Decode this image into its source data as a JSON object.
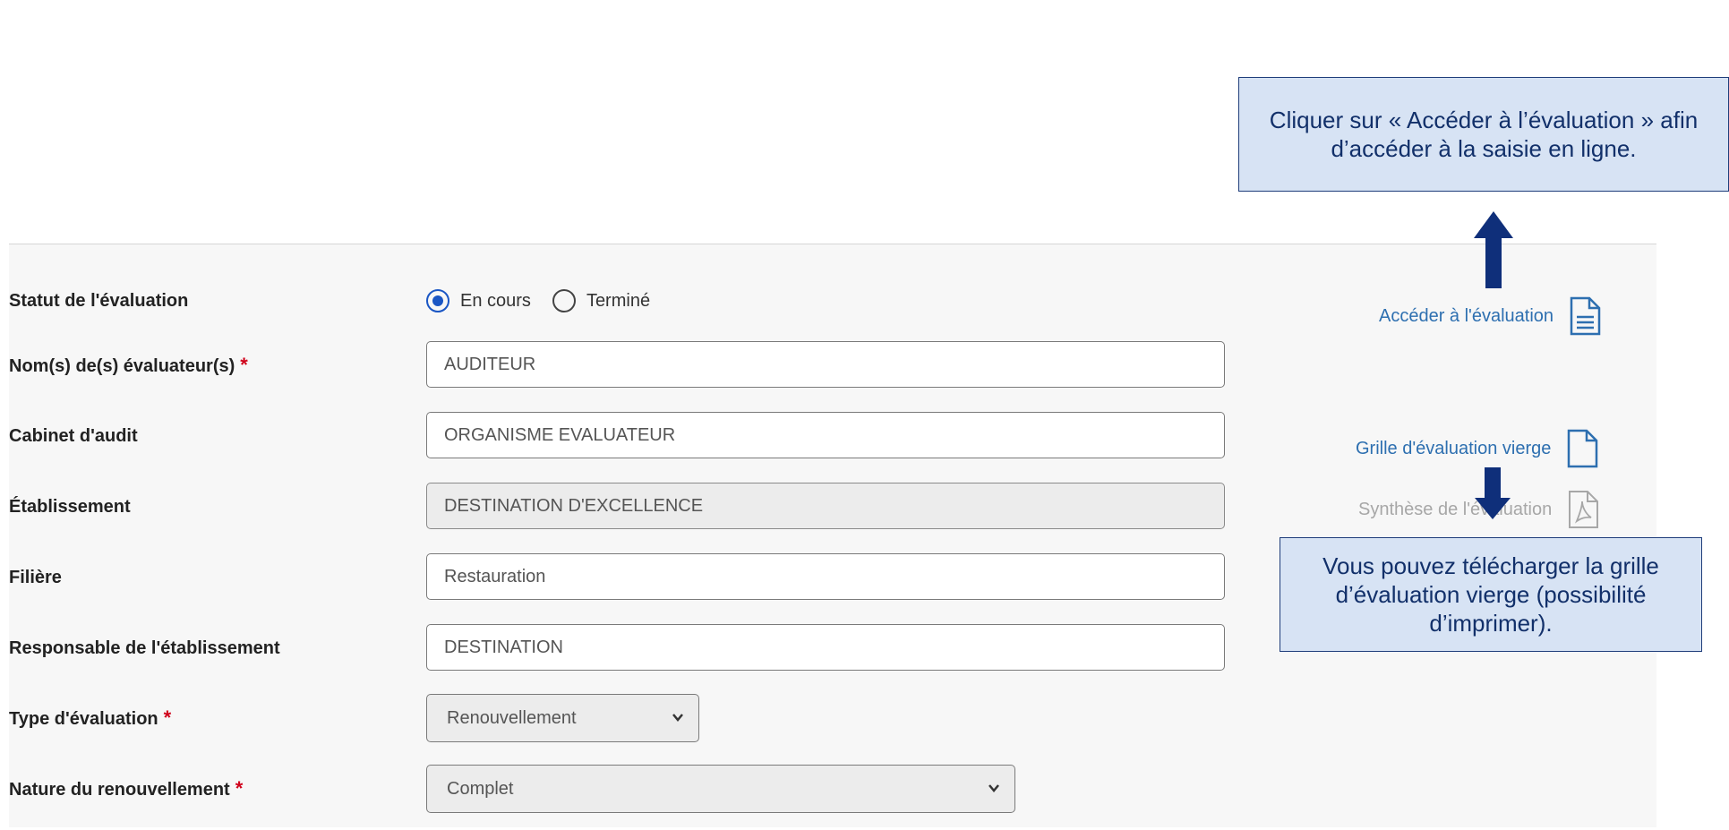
{
  "form": {
    "statut": {
      "label": "Statut de l'évaluation",
      "options": [
        {
          "label": "En cours",
          "checked": true
        },
        {
          "label": "Terminé",
          "checked": false
        }
      ]
    },
    "evaluateurs": {
      "label": "Nom(s) de(s) évaluateur(s)",
      "required": "*",
      "value": "AUDITEUR"
    },
    "cabinet": {
      "label": "Cabinet d'audit",
      "value": "ORGANISME EVALUATEUR"
    },
    "etablissement": {
      "label": "Établissement",
      "value": "DESTINATION D'EXCELLENCE"
    },
    "filiere": {
      "label": "Filière",
      "value": "Restauration"
    },
    "responsable": {
      "label": "Responsable de l'établissement",
      "value": "DESTINATION"
    },
    "type_evaluation": {
      "label": "Type d'évaluation",
      "required": "*",
      "value": "Renouvellement"
    },
    "nature_renouvellement": {
      "label": "Nature du renouvellement",
      "required": "*",
      "value": "Complet"
    }
  },
  "side_links": {
    "acceder": {
      "label": "Accéder à l'évaluation",
      "icon": "document-lines-icon"
    },
    "grille": {
      "label": "Grille d'évaluation vierge",
      "icon": "blank-document-icon"
    },
    "synthese": {
      "label": "Synthèse de l'évaluation",
      "icon": "pdf-icon",
      "disabled": true
    }
  },
  "callouts": {
    "top": "Cliquer sur « Accéder à l’évaluation » afin d’accéder à la saisie en ligne.",
    "bottom": "Vous pouvez télécharger la grille d’évaluation vierge (possibilité d’imprimer)."
  },
  "colors": {
    "link": "#2d6fb0",
    "required": "#d0021b",
    "callout_bg": "#d7e3f4",
    "arrow": "#0f2f7a"
  }
}
